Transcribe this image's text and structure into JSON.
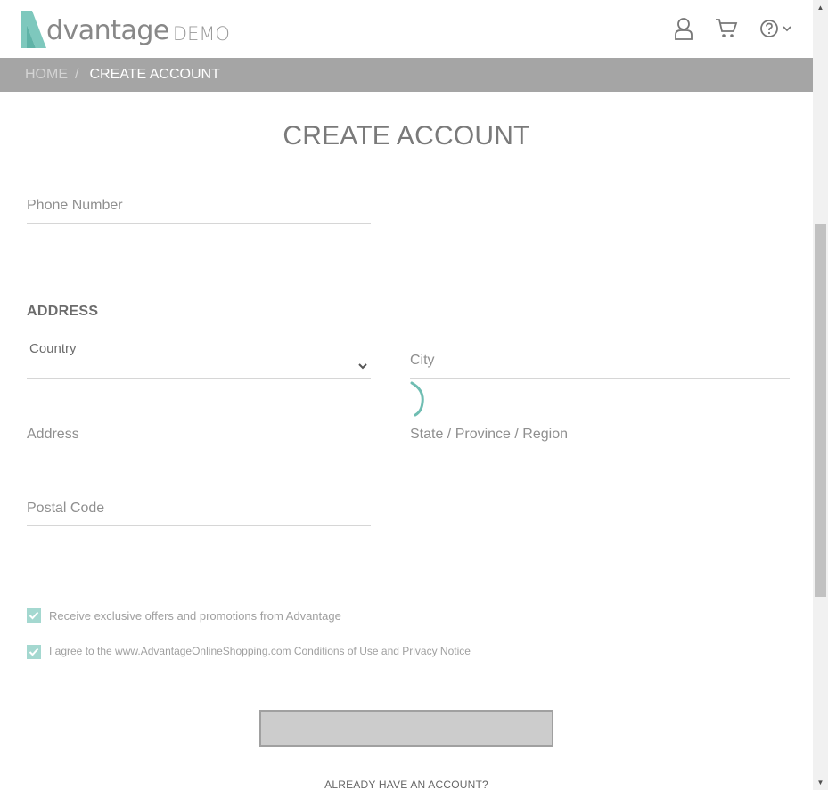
{
  "brand": {
    "logo_text": "dvantage",
    "logo_suffix": "DEMO",
    "accent": "#7ec8bd"
  },
  "header": {
    "icons": [
      "user-icon",
      "cart-icon",
      "help-icon",
      "chevron-down-icon"
    ]
  },
  "breadcrumb": {
    "home": "HOME",
    "separator": "/",
    "current": "CREATE ACCOUNT"
  },
  "page": {
    "title": "CREATE ACCOUNT"
  },
  "form": {
    "phone": {
      "placeholder": "Phone Number",
      "value": ""
    },
    "address_section": "ADDRESS",
    "country": {
      "label": "Country",
      "value": ""
    },
    "city": {
      "placeholder": "City",
      "value": ""
    },
    "address": {
      "placeholder": "Address",
      "value": ""
    },
    "state": {
      "placeholder": "State / Province / Region",
      "value": ""
    },
    "postal": {
      "placeholder": "Postal Code",
      "value": ""
    },
    "offers_checkbox": {
      "label": "Receive exclusive offers and promotions from Advantage",
      "checked": true
    },
    "terms_checkbox": {
      "label": "I agree to the www.AdvantageOnlineShopping.com Conditions of Use and Privacy Notice",
      "checked": true
    },
    "register_label": ""
  },
  "footer": {
    "already_account": "ALREADY HAVE AN ACCOUNT?"
  }
}
